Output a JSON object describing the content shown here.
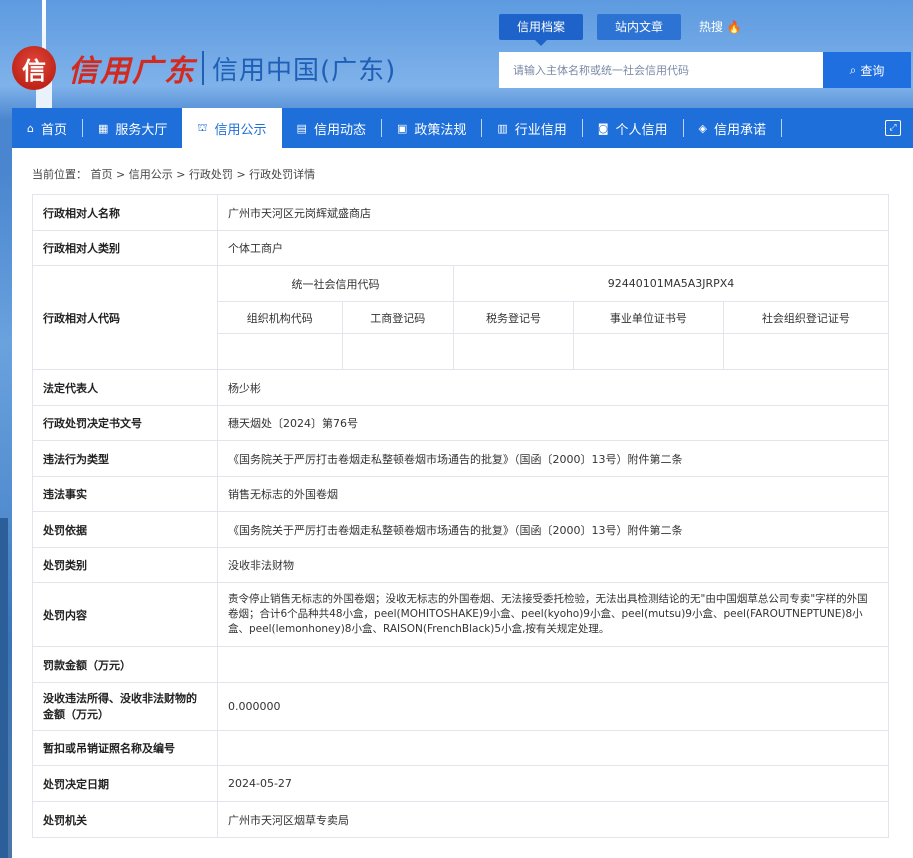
{
  "header": {
    "logo_emblem": "信",
    "logo_script": "信用广东",
    "logo_main": "信用中国(广东)",
    "search_tabs": [
      "信用档案",
      "站内文章",
      "热搜"
    ],
    "search_placeholder": "请输入主体名称或统一社会信用代码",
    "search_button": "查询"
  },
  "nav": [
    {
      "label": "首页",
      "icon": "home-icon",
      "glyph": "⌂"
    },
    {
      "label": "服务大厅",
      "icon": "grid-icon",
      "glyph": "▦"
    },
    {
      "label": "信用公示",
      "icon": "building-icon",
      "glyph": "⛫"
    },
    {
      "label": "信用动态",
      "icon": "document-icon",
      "glyph": "▤"
    },
    {
      "label": "政策法规",
      "icon": "book-icon",
      "glyph": "▣"
    },
    {
      "label": "行业信用",
      "icon": "chart-icon",
      "glyph": "▥"
    },
    {
      "label": "个人信用",
      "icon": "person-card-icon",
      "glyph": "◙"
    },
    {
      "label": "信用承诺",
      "icon": "shield-icon",
      "glyph": "◈"
    }
  ],
  "breadcrumb": {
    "prefix": "当前位置：",
    "items": [
      "首页",
      "信用公示",
      "行政处罚",
      "行政处罚详情"
    ]
  },
  "details": {
    "name_label": "行政相对人名称",
    "name": "广州市天河区元岗辉斌盛商店",
    "type_label": "行政相对人类别",
    "type": "个体工商户",
    "code_label": "行政相对人代码",
    "uscc_label": "统一社会信用代码",
    "uscc": "92440101MA5A3JRPX4",
    "sub_headers": [
      "组织机构代码",
      "工商登记码",
      "税务登记号",
      "事业单位证书号",
      "社会组织登记证号"
    ],
    "sub_values": [
      "",
      "",
      "",
      "",
      ""
    ],
    "legal_rep_label": "法定代表人",
    "legal_rep": "杨少彬",
    "decision_no_label": "行政处罚决定书文号",
    "decision_no": "穗天烟处〔2024〕第76号",
    "violation_type_label": "违法行为类型",
    "violation_type": "《国务院关于严厉打击卷烟走私整顿卷烟市场通告的批复》（国函〔2000〕13号）附件第二条",
    "facts_label": "违法事实",
    "facts": "销售无标志的外国卷烟",
    "basis_label": "处罚依据",
    "basis": "《国务院关于严厉打击卷烟走私整顿卷烟市场通告的批复》（国函〔2000〕13号）附件第二条",
    "category_label": "处罚类别",
    "category": "没收非法财物",
    "content_label": "处罚内容",
    "content": "责令停止销售无标志的外国卷烟；没收无标志的外国卷烟、无法接受委托检验，无法出具检测结论的无\"由中国烟草总公司专卖\"字样的外国卷烟；合计6个品种共48小盒，peel(MOHITOSHAKE)9小盒、peel(kyoho)9小盒、peel(mutsu)9小盒、peel(FAROUTNEPTUNE)8小盒、peel(lemonhoney)8小盒、RAISON(FrenchBlack)5小盒,按有关规定处理。",
    "fine_label": "罚款金额（万元）",
    "fine": "",
    "confiscation_label": "没收违法所得、没收非法财物的金额（万元）",
    "confiscation": "0.000000",
    "license_label": "暂扣或吊销证照名称及编号",
    "license": "",
    "date_label": "处罚决定日期",
    "date": "2024-05-27",
    "authority_label": "处罚机关",
    "authority": "广州市天河区烟草专卖局"
  }
}
